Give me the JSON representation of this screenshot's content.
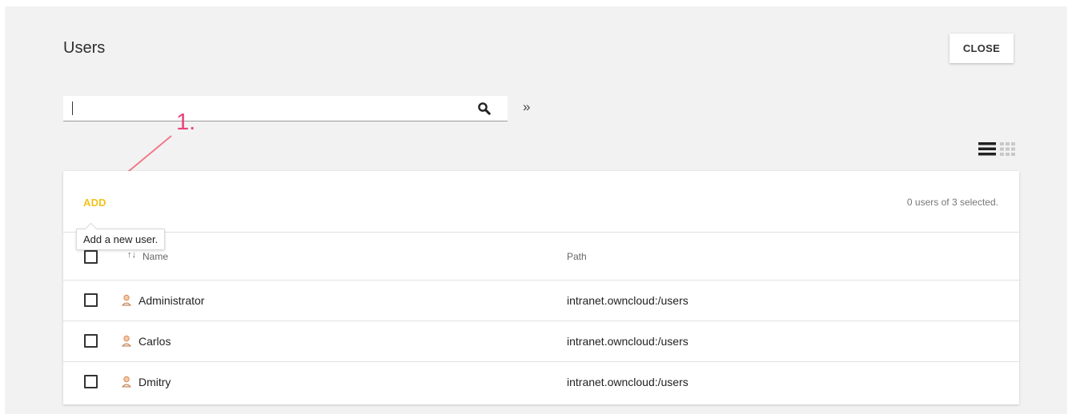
{
  "header": {
    "title": "Users",
    "close_label": "CLOSE"
  },
  "search": {
    "value": "",
    "placeholder": "",
    "expand_glyph": "»"
  },
  "annotation": {
    "number": "1."
  },
  "toolbar": {
    "add_label": "ADD",
    "add_tooltip": "Add a new user.",
    "selection_status": "0 users of 3 selected."
  },
  "table": {
    "columns": [
      "Name",
      "Path"
    ],
    "rows": [
      {
        "name": "Administrator",
        "path": "intranet.owncloud:/users"
      },
      {
        "name": "Carlos",
        "path": "intranet.owncloud:/users"
      },
      {
        "name": "Dmitry",
        "path": "intranet.owncloud:/users"
      }
    ]
  },
  "icons": {
    "search": "search-icon",
    "expand": "double-chevron-right-icon",
    "list_view": "list-view-icon",
    "grid_view": "grid-view-icon",
    "user": "user-icon",
    "sort": "sort-icon"
  },
  "colors": {
    "accent_add": "#f2c21b",
    "annotation": "#e8457b",
    "background": "#f2f2f2"
  }
}
